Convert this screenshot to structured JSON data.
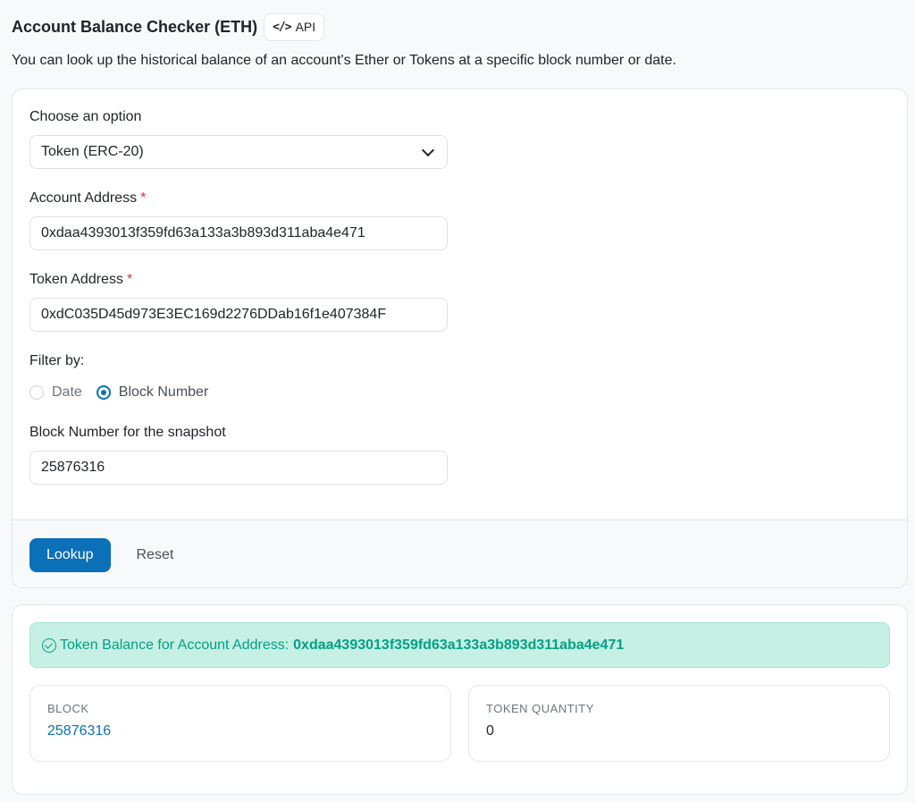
{
  "header": {
    "title": "Account Balance Checker (ETH)",
    "api_label": "API",
    "subtitle": "You can look up the historical balance of an account's Ether or Tokens at a specific block number or date."
  },
  "form": {
    "option_label": "Choose an option",
    "option_value": "Token (ERC-20)",
    "account_label": "Account Address",
    "account_value": "0xdaa4393013f359fd63a133a3b893d311aba4e471",
    "token_label": "Token Address",
    "token_value": "0xdC035D45d973E3EC169d2276DDab16f1e407384F",
    "required_mark": "*",
    "filter_label": "Filter by:",
    "filter_options": [
      "Date",
      "Block Number"
    ],
    "filter_selected": "Block Number",
    "block_label": "Block Number for the snapshot",
    "block_value": "25876316",
    "lookup_label": "Lookup",
    "reset_label": "Reset"
  },
  "result": {
    "alert_text": "Token Balance for Account Address:",
    "alert_address": "0xdaa4393013f359fd63a133a3b893d311aba4e471",
    "block_label": "BLOCK",
    "block_value": "25876316",
    "quantity_label": "TOKEN QUANTITY",
    "quantity_value": "0"
  },
  "colors": {
    "primary": "#0a70b7",
    "success": "#00a186",
    "success_bg": "#c6f0e4",
    "required": "#dc3545"
  },
  "icons": [
    "code-icon",
    "chevron-down-icon",
    "check-circle-icon"
  ]
}
